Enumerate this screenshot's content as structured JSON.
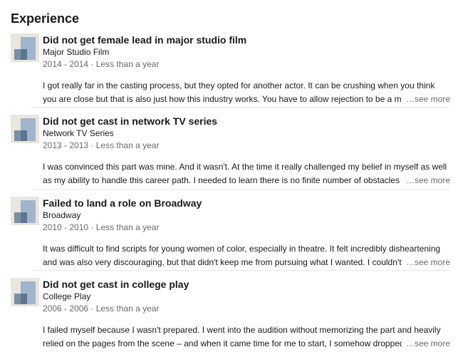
{
  "section": {
    "title": "Experience"
  },
  "entries": [
    {
      "title": "Did not get female lead in major studio film",
      "company": "Major Studio Film",
      "dates": "2014 - 2014 · Less than a year",
      "description": "I got really far in the casting process, but they opted for another actor. It can be crushing when you think you are close but that is also just how this industry works. You have to allow rejection to be a motivat",
      "see_more": "see more"
    },
    {
      "title": "Did not get cast in network TV series",
      "company": "Network TV Series",
      "dates": "2013 - 2013 · Less than a year",
      "description": "I was convinced this part was mine. And it wasn't. At the time it really challenged my belief in myself as well as my ability to handle this career path. I needed to learn there is no finite number of obstacles o",
      "see_more": "see more"
    },
    {
      "title": "Failed to land a role on Broadway",
      "company": "Broadway",
      "dates": "2010 - 2010 · Less than a year",
      "description": "It was difficult to find scripts for young women of color, especially in theatre. It felt incredibly disheartening and was also very discouraging, but that didn't keep me from pursuing what I wanted. I couldn't a",
      "see_more": "see more"
    },
    {
      "title": "Did not get cast in college play",
      "company": "College Play",
      "dates": "2006 - 2006 · Less than a year",
      "description": "I failed myself because I wasn't prepared. I went into the audition without memorizing the part and heavily relied on the pages from the scene – and when it came time for me to start, I somehow dropped",
      "see_more": "see more"
    }
  ],
  "colors": {
    "logo_background": "#e9e5df",
    "logo_tall_block": "#a0b4cb",
    "logo_small_block": "#788fa5",
    "divider": "#e8e8e8"
  },
  "icons": {
    "company_logo": "company-logo-icon"
  }
}
